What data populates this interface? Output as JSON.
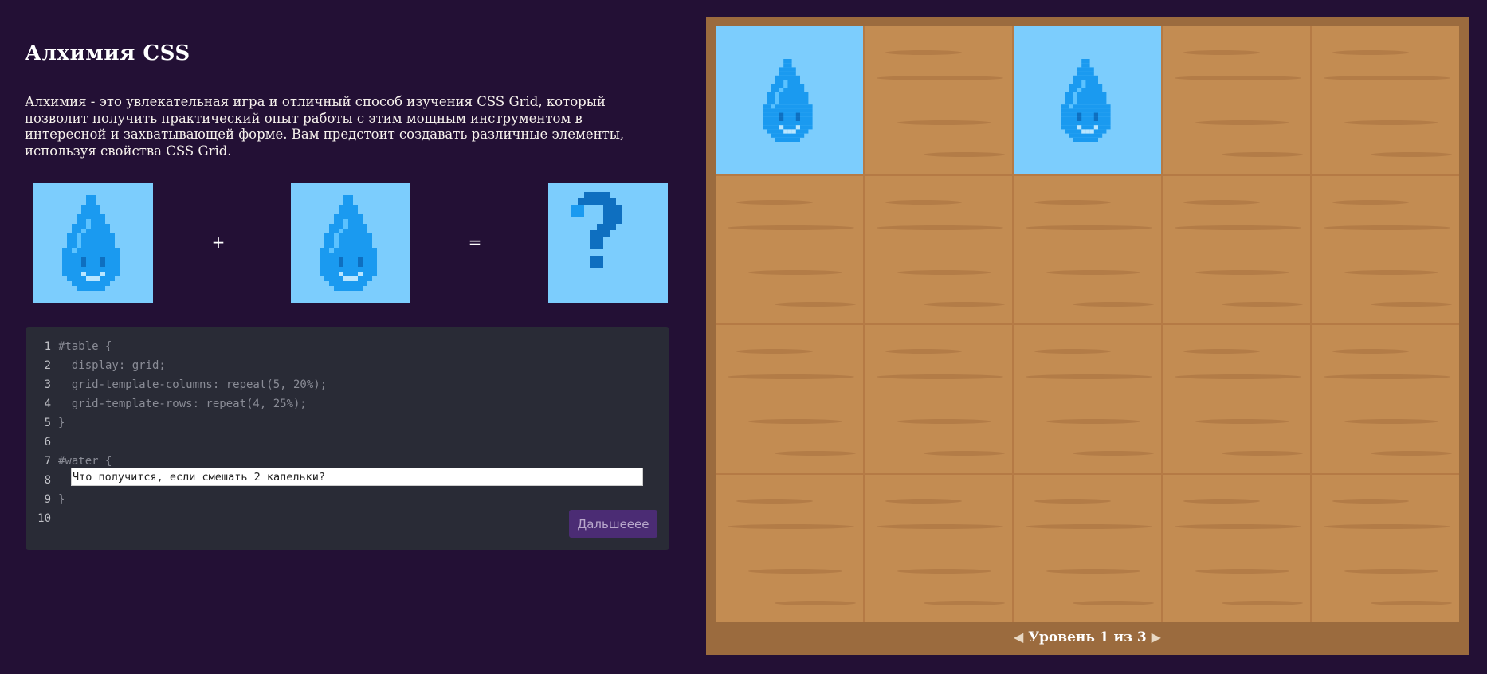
{
  "title": "Алхимия CSS",
  "description": "Алхимия - это увлекательная игра и отличный способ изучения CSS Grid, который позволит получить практический опыт работы с этим мощным инструментом в интересной и захватывающей форме. Вам предстоит создавать различные элементы, используя свойства CSS Grid.",
  "formula": {
    "item1": "water-drop-icon",
    "plus": "+",
    "item2": "water-drop-icon",
    "equals": "=",
    "result": "question-mark-icon"
  },
  "editor": {
    "line_numbers": [
      "1",
      "2",
      "3",
      "4",
      "5",
      "6",
      "7",
      "8",
      "9",
      "10"
    ],
    "lines": [
      "#table {",
      "  display: grid;",
      "  grid-template-columns: repeat(5, 20%);",
      "  grid-template-rows: repeat(4, 25%);",
      "}",
      "",
      "#water {",
      "",
      "}",
      ""
    ],
    "answer_placeholder": "Что получится, если смешать 2 капельки?",
    "next_label": "Дальшееее"
  },
  "board": {
    "columns": 5,
    "rows": 4,
    "water_cells": [
      0,
      2
    ],
    "level_prev": "◀",
    "level_text": "Уровень 1 из 3",
    "level_next": "▶"
  },
  "colors": {
    "background": "#231035",
    "tile": "#7ccdfd",
    "wood": "#c38c52",
    "water": "#1a9af0"
  }
}
